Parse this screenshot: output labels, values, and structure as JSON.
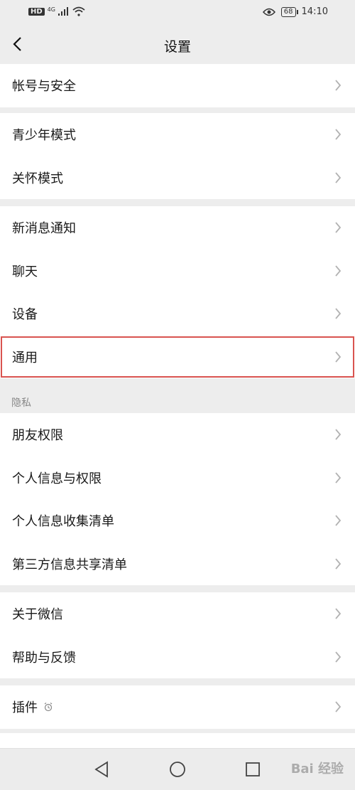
{
  "status_bar": {
    "hd": "HD",
    "network": "4G",
    "battery": "68",
    "time": "14:10"
  },
  "nav": {
    "title": "设置"
  },
  "groups": [
    {
      "items": [
        {
          "label": "帐号与安全"
        }
      ]
    },
    {
      "items": [
        {
          "label": "青少年模式"
        },
        {
          "label": "关怀模式"
        }
      ]
    },
    {
      "items": [
        {
          "label": "新消息通知"
        },
        {
          "label": "聊天"
        },
        {
          "label": "设备"
        },
        {
          "label": "通用",
          "highlighted": true
        }
      ]
    },
    {
      "section_label": "隐私",
      "items": [
        {
          "label": "朋友权限"
        },
        {
          "label": "个人信息与权限"
        },
        {
          "label": "个人信息收集清单"
        },
        {
          "label": "第三方信息共享清单"
        }
      ]
    },
    {
      "items": [
        {
          "label": "关于微信"
        },
        {
          "label": "帮助与反馈"
        }
      ]
    },
    {
      "items": [
        {
          "label": "插件"
        }
      ]
    }
  ],
  "watermark": "Bai 经验",
  "colors": {
    "background": "#ededed",
    "card": "#ffffff",
    "highlight_border": "#d9534f",
    "chevron": "#b2b2b2"
  }
}
